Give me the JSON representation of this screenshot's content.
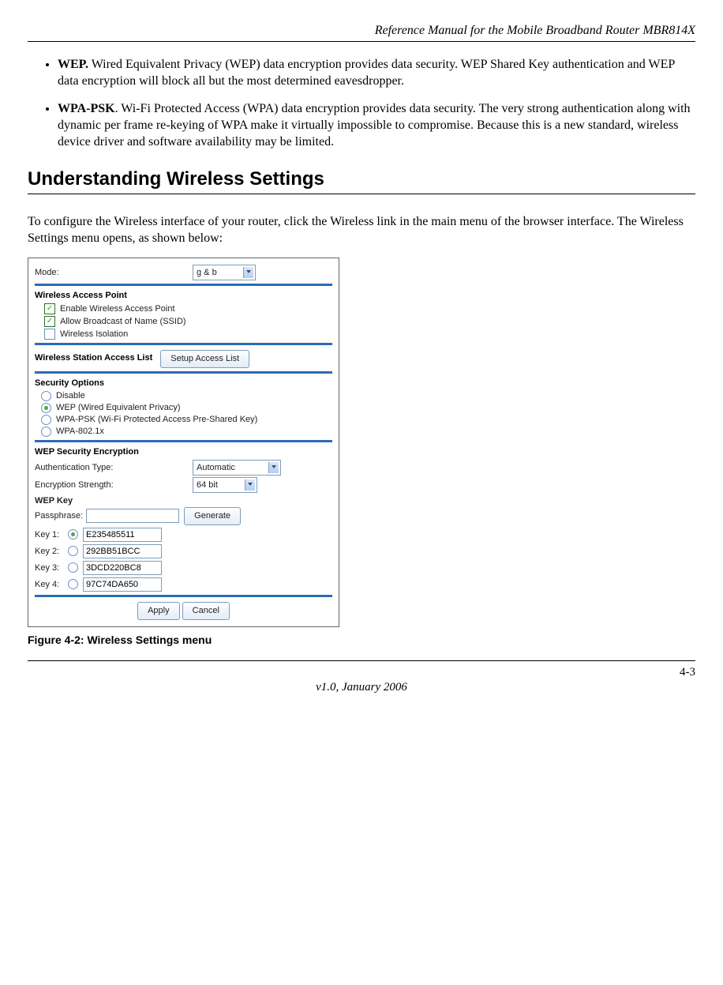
{
  "header": {
    "title": "Reference Manual for the Mobile Broadband Router MBR814X"
  },
  "bullets": {
    "wep": {
      "lead": "WEP.",
      "text": " Wired Equivalent Privacy (WEP) data encryption provides data security. WEP Shared Key authentication and WEP data encryption will block all but the most determined eavesdropper."
    },
    "wpa": {
      "lead": "WPA-PSK",
      "text": ". Wi-Fi Protected Access (WPA) data encryption provides data security. The very strong authentication along with dynamic per frame re-keying of WPA make it virtually impossible to compromise. Because this is a new standard, wireless device driver and software availability may be limited."
    }
  },
  "section_heading": "Understanding Wireless Settings",
  "intro": "To configure the Wireless interface of your router, click the Wireless link in the main menu of the browser interface. The Wireless Settings menu opens, as shown below:",
  "shot": {
    "mode_label": "Mode:",
    "mode_value": "g & b",
    "wap_head": "Wireless Access Point",
    "wap_opts": {
      "enable": "Enable Wireless Access Point",
      "broadcast": "Allow Broadcast of Name (SSID)",
      "isolation": "Wireless Isolation"
    },
    "wsal_label": "Wireless Station Access List",
    "wsal_button": "Setup Access List",
    "sec_head": "Security Options",
    "sec_opts": {
      "disable": "Disable",
      "wep": "WEP (Wired Equivalent Privacy)",
      "wpapsk": "WPA-PSK (Wi-Fi Protected Access Pre-Shared Key)",
      "wpa8021x": "WPA-802.1x"
    },
    "wepenc_head": "WEP Security Encryption",
    "auth_label": "Authentication Type:",
    "auth_value": "Automatic",
    "enc_label": "Encryption Strength:",
    "enc_value": "64 bit",
    "wepkey_head": "WEP Key",
    "pass_label": "Passphrase:",
    "generate": "Generate",
    "keys": {
      "k1l": "Key 1:",
      "k1v": "E235485511",
      "k2l": "Key 2:",
      "k2v": "292BB51BCC",
      "k3l": "Key 3:",
      "k3v": "3DCD220BC8",
      "k4l": "Key 4:",
      "k4v": "97C74DA650"
    },
    "apply": "Apply",
    "cancel": "Cancel"
  },
  "figure_caption": "Figure 4-2:  Wireless Settings menu",
  "footer": {
    "pagenum": "4-3",
    "version": "v1.0, January 2006"
  }
}
